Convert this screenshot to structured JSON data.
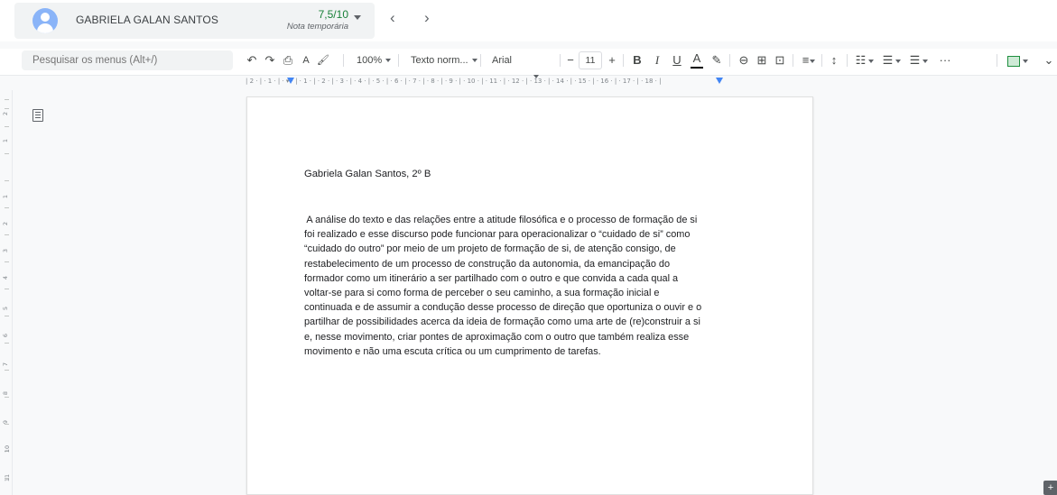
{
  "student": {
    "name": "GABRIELA GALAN SANTOS",
    "grade_value": "7,5/10",
    "grade_label": "Nota temporária"
  },
  "navigation": {
    "prev_glyph": "‹",
    "next_glyph": "›"
  },
  "toolbar": {
    "menu_search_placeholder": "Pesquisar os menus (Alt+/)",
    "undo_icon": "↶",
    "redo_icon": "↷",
    "print_icon": "⎙",
    "spellcheck_icon": "A",
    "paint_format_icon": "🖌",
    "zoom": "100%",
    "style": "Texto norm...",
    "font": "Arial",
    "font_size": "11",
    "decrease_size": "−",
    "increase_size": "+",
    "bold": "B",
    "italic": "I",
    "underline": "U",
    "text_color": "A",
    "more": "···"
  },
  "ruler": {
    "text": "| 2 · | · 1 · | · ▾ · | · 1 · | · 2 · | · 3 · | · 4 · | · 5 · | · 6 · | · 7 · | · 8 · | · 9 · | · 10 · | · 11 · | · 12 · | · 13 · | · 14 · | · 15 · | · 16 · | · 17 · | · 18 · |"
  },
  "document": {
    "heading": "Gabriela Galan Santos, 2º B",
    "body_lines": [
      " A análise do texto e das relações entre a atitude filosófica e o processo de formação de si",
      "foi realizado e esse discurso pode funcionar para operacionalizar o “cuidado de si” como",
      "“cuidado do outro” por meio de um projeto de formação de si, de atenção consigo, de",
      "restabelecimento de um processo de construção da autonomia, da emancipação do",
      "formador como um itinerário a ser partilhado com o outro e que convida a cada qual a",
      "voltar-se para si como forma de perceber o seu caminho, a sua formação inicial e",
      "continuada e de assumir a condução desse processo de direção que oportuniza o ouvir e o",
      "partilhar de possibilidades acerca da ideia de formação como uma arte de (re)construir a si",
      "e, nesse movimento, criar pontes de aproximação com o outro que também realiza esse",
      "movimento e não uma escuta crítica ou um cumprimento de tarefas."
    ]
  },
  "vertical_ruler_numbers": [
    "2",
    "1",
    "1",
    "2",
    "3",
    "4",
    "5",
    "6",
    "7",
    "8",
    "9",
    "10",
    "11"
  ]
}
